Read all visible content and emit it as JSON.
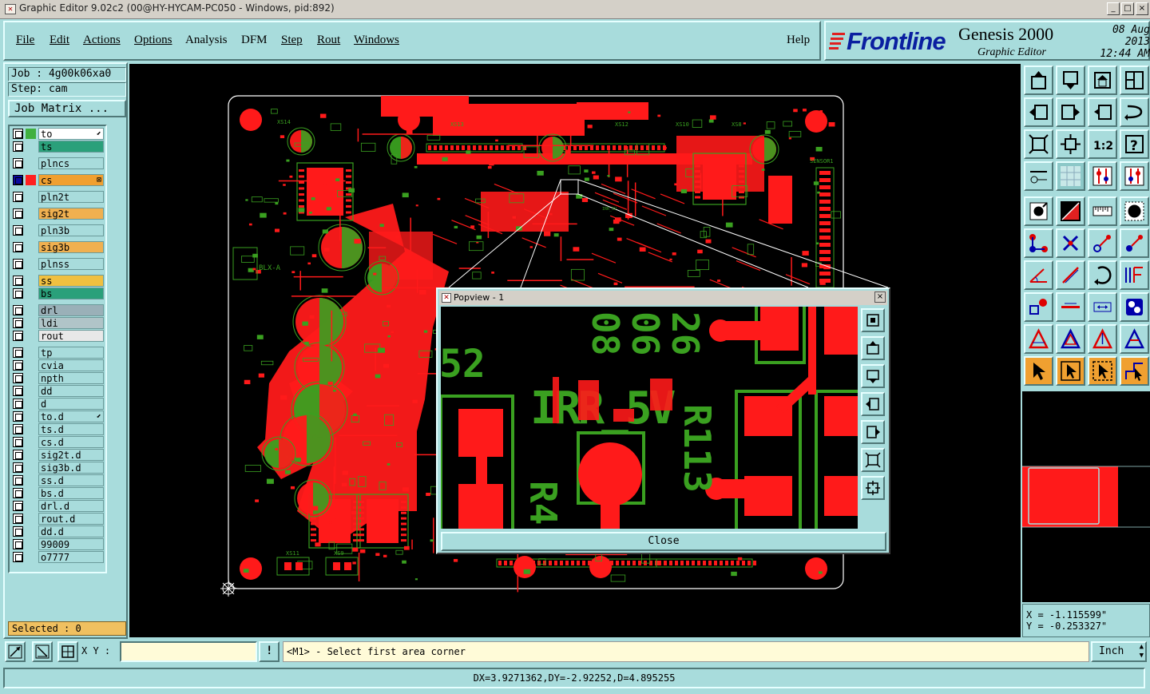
{
  "window": {
    "title": "Graphic Editor 9.02c2 (00@HY-HYCAM-PC050 - Windows, pid:892)",
    "btn_min": "_",
    "btn_max": "□",
    "btn_close": "×"
  },
  "menu": {
    "file": "File",
    "edit": "Edit",
    "actions": "Actions",
    "options": "Options",
    "analysis": "Analysis",
    "dfm": "DFM",
    "step": "Step",
    "rout": "Rout",
    "windows": "Windows",
    "help": "Help"
  },
  "brand": {
    "logo_text": "Frontline",
    "product": "Genesis 2000",
    "subtitle": "Graphic Editor",
    "date": "08 Aug 2013",
    "time": "12:44 AM"
  },
  "job": {
    "job_label": "Job : 4g00k06xa0",
    "step_label": "Step: cam",
    "matrix_button": "Job Matrix ..."
  },
  "layers": [
    {
      "name": "to",
      "color": "#ffffff",
      "swatch": "#40b040",
      "mark": "⬋"
    },
    {
      "name": "ts",
      "color": "#2aa07a",
      "swatch": "",
      "mark": ""
    },
    {
      "name": "plncs",
      "color": "#a8dcdc",
      "swatch": "",
      "mark": ""
    },
    {
      "name": "cs",
      "color": "#f0a030",
      "swatch": "#ff2020",
      "mark": "⊠"
    },
    {
      "name": "pln2t",
      "color": "#a8dcdc",
      "swatch": "",
      "mark": ""
    },
    {
      "name": "sig2t",
      "color": "#f0b050",
      "swatch": "",
      "mark": ""
    },
    {
      "name": "pln3b",
      "color": "#a8dcdc",
      "swatch": "",
      "mark": ""
    },
    {
      "name": "sig3b",
      "color": "#f0b050",
      "swatch": "",
      "mark": ""
    },
    {
      "name": "plnss",
      "color": "#a8dcdc",
      "swatch": "",
      "mark": ""
    },
    {
      "name": "ss",
      "color": "#f0c040",
      "swatch": "",
      "mark": ""
    },
    {
      "name": "bs",
      "color": "#2aa07a",
      "swatch": "",
      "mark": ""
    },
    {
      "name": "drl",
      "color": "#9ab0b8",
      "swatch": "",
      "mark": ""
    },
    {
      "name": "ldi",
      "color": "#b0c4c8",
      "swatch": "",
      "mark": ""
    },
    {
      "name": "rout",
      "color": "#e8e8e8",
      "swatch": "",
      "mark": ""
    },
    {
      "name": "tp",
      "color": "#a8dcdc",
      "swatch": "",
      "mark": ""
    },
    {
      "name": "cvia",
      "color": "#a8dcdc",
      "swatch": "",
      "mark": ""
    },
    {
      "name": "npth",
      "color": "#a8dcdc",
      "swatch": "",
      "mark": ""
    },
    {
      "name": "dd",
      "color": "#a8dcdc",
      "swatch": "",
      "mark": ""
    },
    {
      "name": "d",
      "color": "#a8dcdc",
      "swatch": "",
      "mark": ""
    },
    {
      "name": "to.d",
      "color": "#a8dcdc",
      "swatch": "",
      "mark": "⬋"
    },
    {
      "name": "ts.d",
      "color": "#a8dcdc",
      "swatch": "",
      "mark": ""
    },
    {
      "name": "cs.d",
      "color": "#a8dcdc",
      "swatch": "",
      "mark": ""
    },
    {
      "name": "sig2t.d",
      "color": "#a8dcdc",
      "swatch": "",
      "mark": ""
    },
    {
      "name": "sig3b.d",
      "color": "#a8dcdc",
      "swatch": "",
      "mark": ""
    },
    {
      "name": "ss.d",
      "color": "#a8dcdc",
      "swatch": "",
      "mark": ""
    },
    {
      "name": "bs.d",
      "color": "#a8dcdc",
      "swatch": "",
      "mark": ""
    },
    {
      "name": "drl.d",
      "color": "#a8dcdc",
      "swatch": "",
      "mark": ""
    },
    {
      "name": "rout.d",
      "color": "#a8dcdc",
      "swatch": "",
      "mark": ""
    },
    {
      "name": "dd.d",
      "color": "#a8dcdc",
      "swatch": "",
      "mark": ""
    },
    {
      "name": "99009",
      "color": "#a8dcdc",
      "swatch": "",
      "mark": ""
    },
    {
      "name": "o7777",
      "color": "#a8dcdc",
      "swatch": "",
      "mark": ""
    }
  ],
  "selected": "Selected : 0",
  "board_labels": {
    "blx": "BLX-A",
    "xs13": "XS13",
    "xs12": "XS12",
    "xs10": "XS10",
    "xs8": "XS8",
    "xs11": "XS11",
    "xs9": "XS9",
    "sensor": "SENSOR1",
    "xs14": "XS14",
    "irr5v_small": "IRR_5V"
  },
  "popview": {
    "title": "Popview - 1",
    "close_label": "Close",
    "txt_52": "52",
    "txt_irr": "IRR_5V",
    "txt_r4": "R4",
    "txt_r113": "R113",
    "txt_08": "08",
    "txt_06": "06",
    "txt_26": "26",
    "close_x": "×"
  },
  "coords": {
    "x": "X  =  -1.115599\"",
    "y": "Y  =  -0.253327\""
  },
  "cmd": {
    "xy_label": "X Y :",
    "xy_value": "",
    "bang": "!",
    "prompt": "<M1> - Select first area corner",
    "unit": "Inch"
  },
  "status": "DX=3.9271362,DY=-2.92252,D=4.895255",
  "colors": {
    "panel": "#a8dcdc",
    "copper": "#ff1a1a",
    "silk": "#3aa020",
    "accent": "#f0a030"
  }
}
